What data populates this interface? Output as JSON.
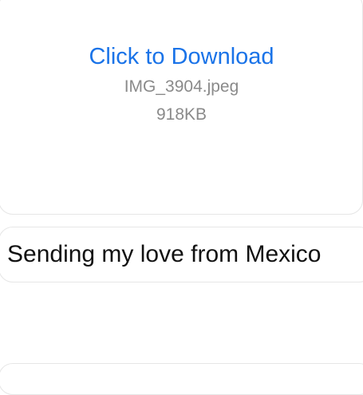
{
  "attachment": {
    "link_label": "Click to Download",
    "file_name": "IMG_3904.jpeg",
    "file_size": "918KB"
  },
  "message": {
    "text": "Sending my love from Mexico"
  },
  "colors": {
    "link": "#1a73e8",
    "secondary_text": "#8a8a8a",
    "bubble_border": "#e6e6e6"
  }
}
